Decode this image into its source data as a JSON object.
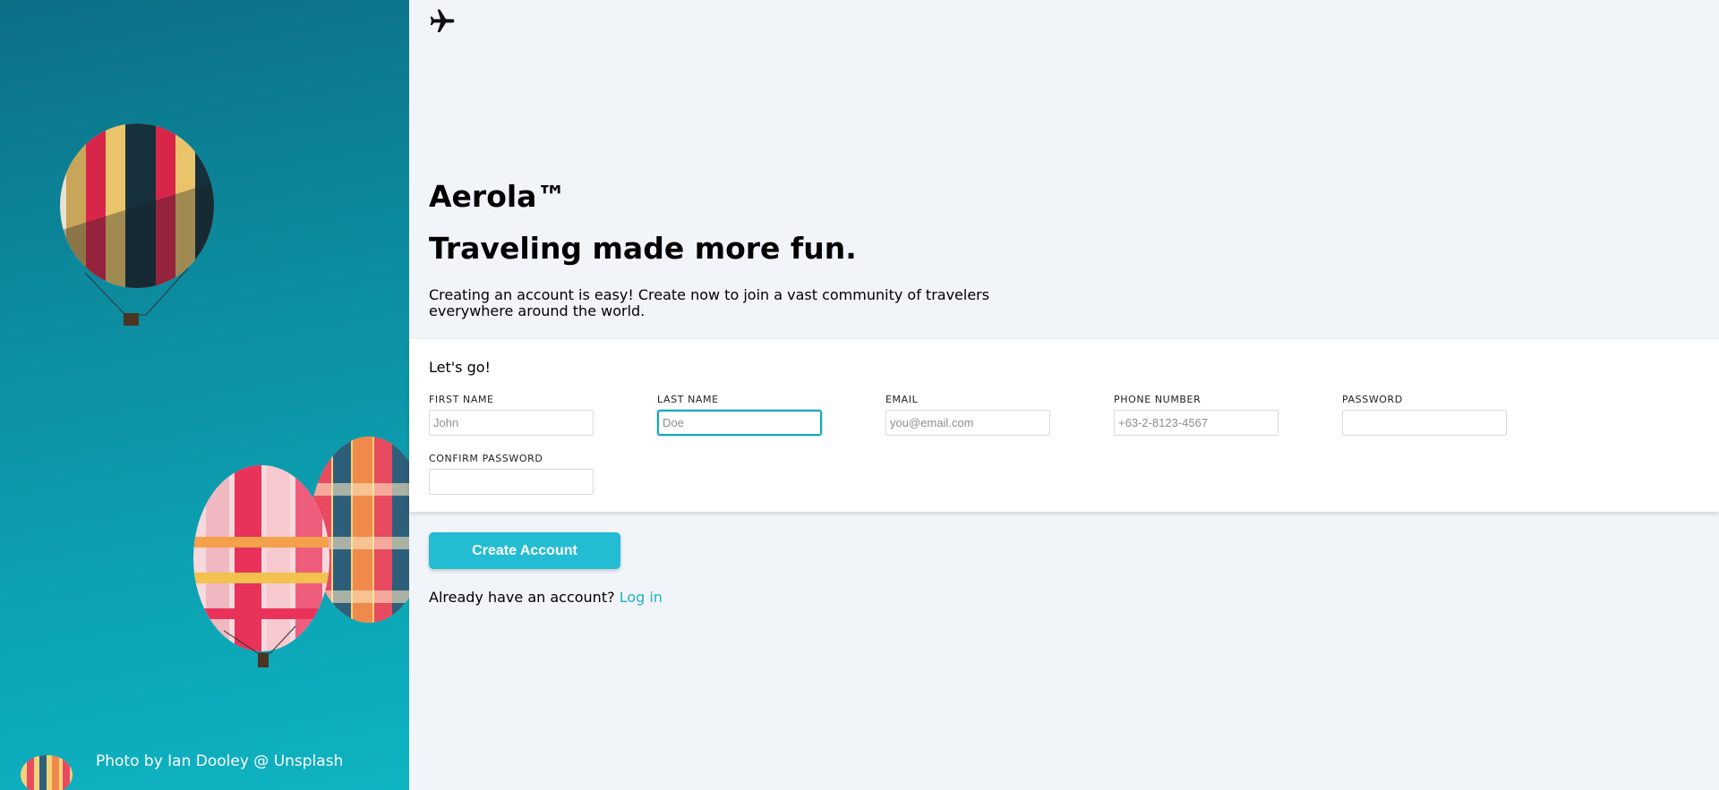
{
  "photo": {
    "credit": "Photo by Ian Dooley @ Unsplash"
  },
  "header": {
    "logo_icon": "airplane-icon"
  },
  "hero": {
    "brand": "Aerola™",
    "headline": "Traveling made more fun.",
    "intro": "Creating an account is easy! Create now to join a vast community of travelers everywhere around the world."
  },
  "form": {
    "title": "Let's go!",
    "fields": {
      "first_name": {
        "label": "FIRST NAME",
        "placeholder": "John",
        "value": ""
      },
      "last_name": {
        "label": "LAST NAME",
        "placeholder": "Doe",
        "value": ""
      },
      "email": {
        "label": "EMAIL",
        "placeholder": "you@email.com",
        "value": ""
      },
      "phone": {
        "label": "PHONE NUMBER",
        "placeholder": "+63-2-8123-4567",
        "value": ""
      },
      "password": {
        "label": "PASSWORD",
        "placeholder": "",
        "value": ""
      },
      "confirm_password": {
        "label": "CONFIRM PASSWORD",
        "placeholder": "",
        "value": ""
      }
    },
    "submit_label": "Create Account",
    "login_prompt": "Already have an account?",
    "login_link": "Log in"
  },
  "colors": {
    "accent": "#24bcd3",
    "link": "#1fb2c8",
    "page_background": "#f1f5f9",
    "card_background": "#ffffff",
    "sky_top": "#0b6f86",
    "sky_bottom": "#0eb3c2"
  }
}
